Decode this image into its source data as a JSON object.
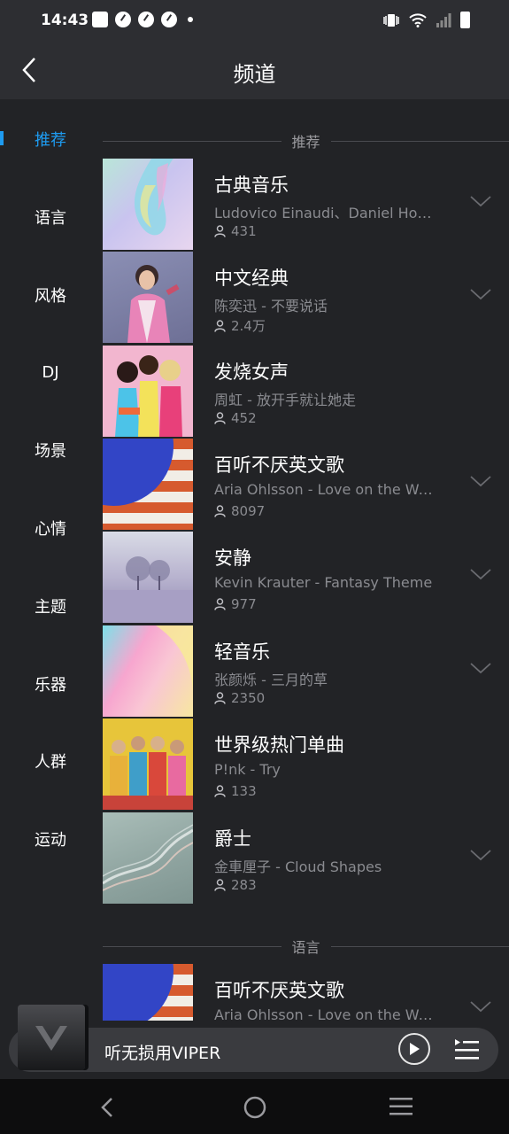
{
  "status": {
    "time": "14:43"
  },
  "header": {
    "title": "频道"
  },
  "sidebar": {
    "items": [
      {
        "label": "推荐",
        "active": true
      },
      {
        "label": "语言"
      },
      {
        "label": "风格"
      },
      {
        "label": "DJ"
      },
      {
        "label": "场景"
      },
      {
        "label": "心情"
      },
      {
        "label": "主题"
      },
      {
        "label": "乐器"
      },
      {
        "label": "人群"
      },
      {
        "label": "运动"
      }
    ]
  },
  "sections": [
    {
      "title": "推荐"
    },
    {
      "title": "语言"
    }
  ],
  "channels": [
    {
      "name": "古典音乐",
      "song": "Ludovico Einaudi、Daniel Hope、I Virtuosi Italiani - Experience",
      "count": "431",
      "cover": "cover-pastel-swirl"
    },
    {
      "name": "中文经典",
      "song": "陈奕迅 - 不要说话",
      "count": "2.4万",
      "cover": "cover-singer-portrait"
    },
    {
      "name": "发烧女声",
      "song": "周虹 - 放开手就让她走",
      "count": "452",
      "cover": "cover-three-women"
    },
    {
      "name": "百听不厌英文歌",
      "song": "Aria Ohlsson - Love on the Weekend",
      "count": "8097",
      "cover": "cover-blue-circle-stripes"
    },
    {
      "name": "安静",
      "song": "Kevin Krauter - Fantasy Theme",
      "count": "977",
      "cover": "cover-frosty-trees"
    },
    {
      "name": "轻音乐",
      "song": "张颜烁 - 三月的草",
      "count": "2350",
      "cover": "cover-pink-gradient"
    },
    {
      "name": "世界级热门单曲",
      "song": "P!nk - Try",
      "count": "133",
      "cover": "cover-band-photo"
    },
    {
      "name": "爵士",
      "song": "金車厘子 - Cloud Shapes",
      "count": "283",
      "cover": "cover-smoke-waves"
    }
  ],
  "second_section_channels": [
    {
      "name": "百听不厌英文歌",
      "song": "Aria Ohlsson - Love on the Weekend",
      "cover": "cover-blue-circle-stripes"
    }
  ],
  "player": {
    "title": "听无损用VIPER"
  },
  "colors": {
    "accent": "#1e9bf0",
    "background": "#222326",
    "header": "#2d2e32"
  }
}
